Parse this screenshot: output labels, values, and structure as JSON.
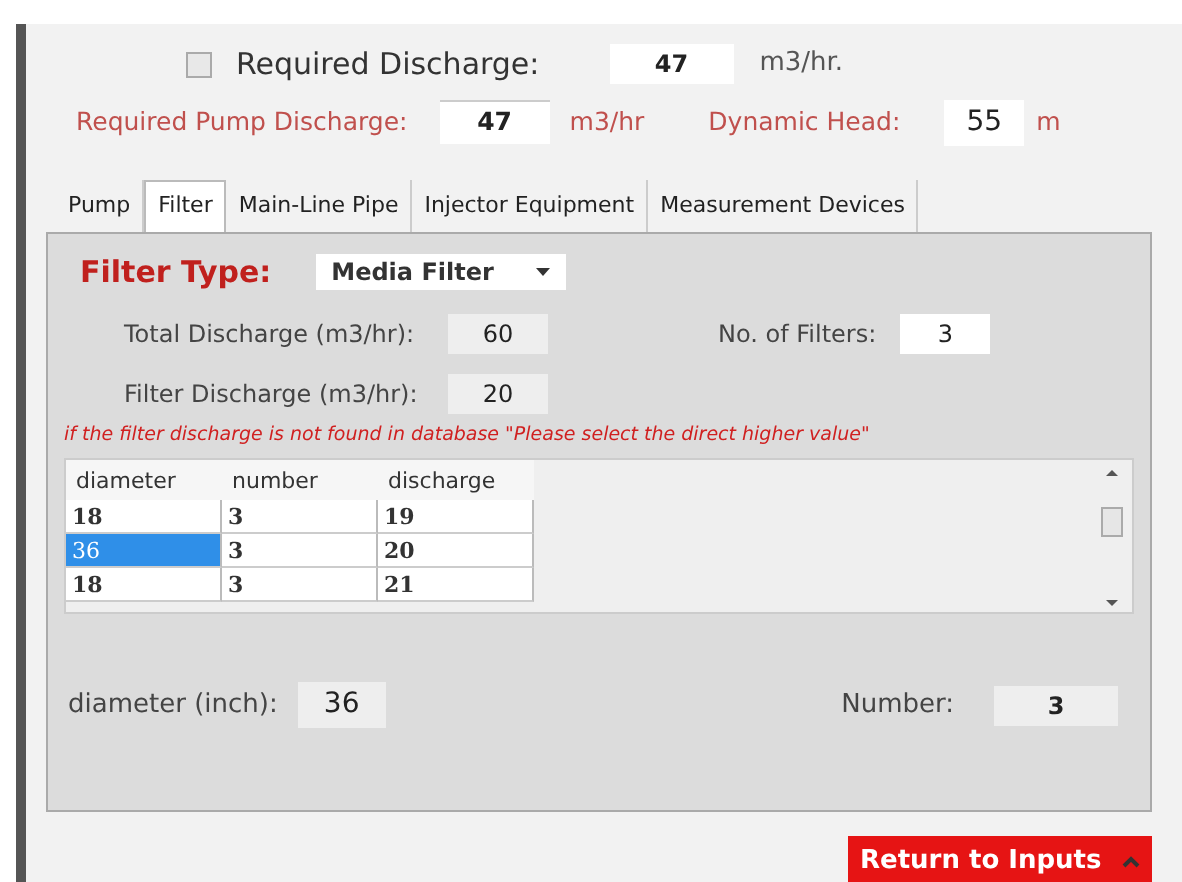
{
  "required_discharge": {
    "checked": false,
    "label": "Required Discharge:",
    "value": "47",
    "unit": "m3/hr."
  },
  "pump_discharge": {
    "label": "Required Pump Discharge:",
    "value": "47",
    "unit": "m3/hr"
  },
  "dynamic_head": {
    "label": "Dynamic Head:",
    "value": "55",
    "unit": "m"
  },
  "tabs": [
    {
      "label": "Pump",
      "selected": false
    },
    {
      "label": "Filter",
      "selected": true
    },
    {
      "label": "Main-Line Pipe",
      "selected": false
    },
    {
      "label": "Injector Equipment",
      "selected": false
    },
    {
      "label": "Measurement Devices",
      "selected": false
    }
  ],
  "filter_type": {
    "label": "Filter Type:",
    "value": "Media Filter"
  },
  "total_discharge": {
    "label": "Total Discharge (m3/hr):",
    "value": "60"
  },
  "no_of_filters": {
    "label": "No. of Filters:",
    "value": "3"
  },
  "filter_discharge": {
    "label": "Filter Discharge (m3/hr):",
    "value": "20"
  },
  "note": "if the filter discharge is not found in database \"Please select the direct higher value\"",
  "table": {
    "columns": [
      "diameter",
      "number",
      "discharge"
    ],
    "rows": [
      {
        "cells": [
          "18",
          "3",
          "19"
        ],
        "selected": false
      },
      {
        "cells": [
          "36",
          "3",
          "20"
        ],
        "selected": true
      },
      {
        "cells": [
          "18",
          "3",
          "21"
        ],
        "selected": false
      }
    ]
  },
  "diameter": {
    "label": "diameter (inch):",
    "value": "36"
  },
  "number": {
    "label": "Number:",
    "value": "3"
  },
  "return_button": "Return to Inputs"
}
